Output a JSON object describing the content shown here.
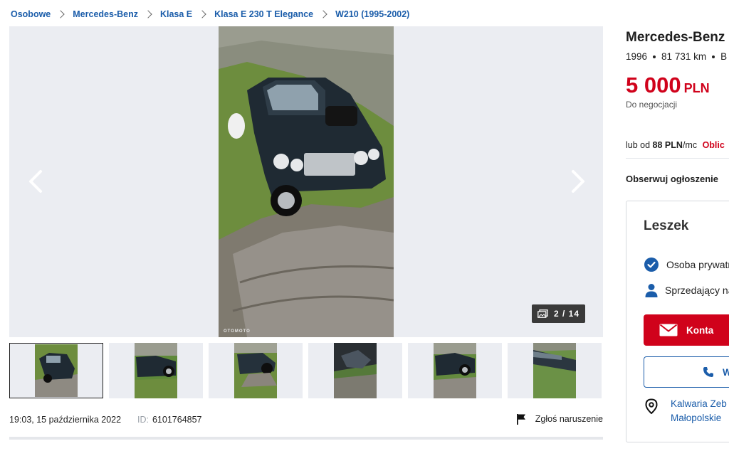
{
  "breadcrumb": [
    "Osobowe",
    "Mercedes-Benz",
    "Klasa E",
    "Klasa E 230 T Elegance",
    "W210 (1995-2002)"
  ],
  "gallery": {
    "counter": "2 / 14",
    "watermark": "OTOMOTO"
  },
  "meta": {
    "date": "19:03, 15 października 2022",
    "id_label": "ID:",
    "id_value": "6101764857",
    "report": "Zgłoś naruszenie"
  },
  "listing": {
    "title": "Mercedes-Benz K",
    "year": "1996",
    "mileage": "81 731 km",
    "fuel_partial": "B",
    "price": "5 000",
    "currency": "PLN",
    "negotiation": "Do negocjacji",
    "finance_prefix": "lub od",
    "finance_amount": "88 PLN",
    "finance_suffix": "/mc",
    "finance_cta": "Oblic",
    "follow": "Obserwuj ogłoszenie"
  },
  "seller": {
    "name": "Leszek",
    "type": "Osoba prywatn",
    "since": "Sprzedający na",
    "contact_button": "Konta",
    "phone_button": "W",
    "location_line1": "Kalwaria Zeb",
    "location_line2": "Małopolskie"
  },
  "colors": {
    "link": "#1b5daa",
    "price": "#d0021b",
    "accent_button": "#d0021b"
  }
}
